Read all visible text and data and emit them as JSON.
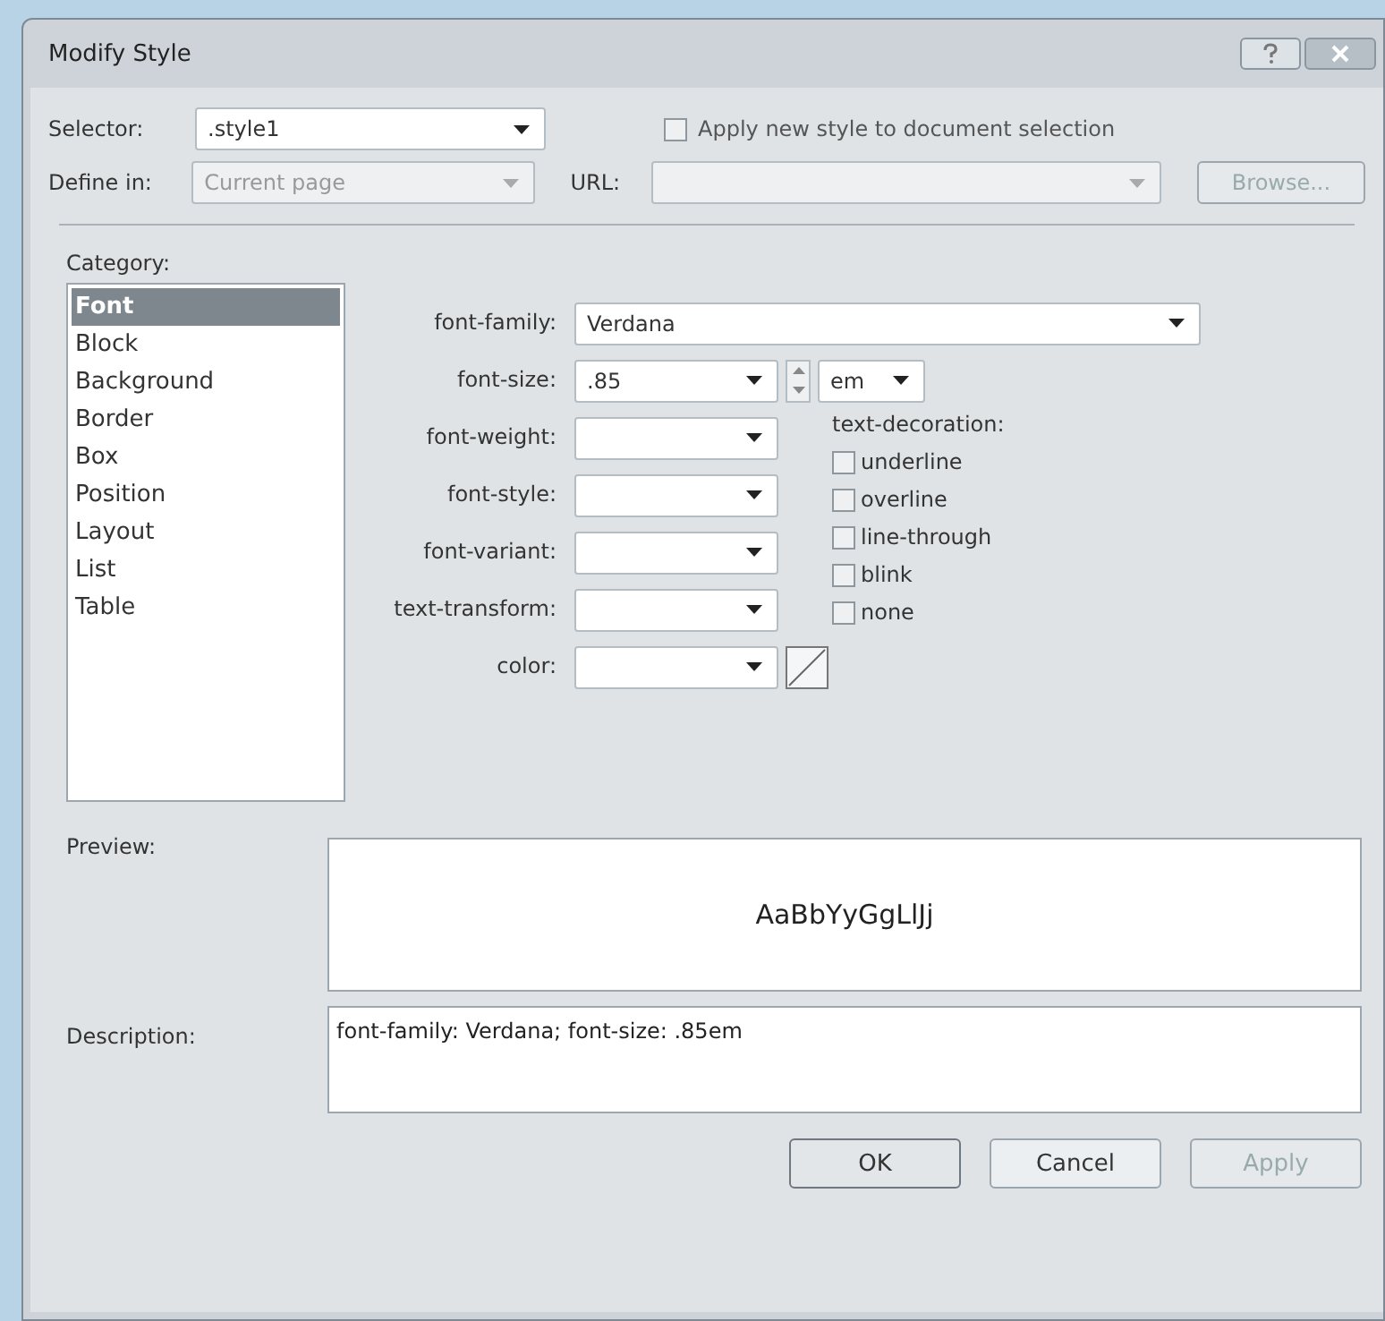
{
  "window": {
    "title": "Modify Style"
  },
  "selector": {
    "label": "Selector:",
    "value": ".style1"
  },
  "apply_to_selection": {
    "label": "Apply new style to document selection",
    "checked": false
  },
  "define_in": {
    "label": "Define in:",
    "value": "Current page",
    "disabled": true
  },
  "url": {
    "label": "URL:",
    "disabled": true
  },
  "browse_button": {
    "label": "Browse...",
    "disabled": true
  },
  "category": {
    "label": "Category:",
    "items": [
      {
        "label": "Font",
        "selected": true
      },
      {
        "label": "Block",
        "selected": false
      },
      {
        "label": "Background",
        "selected": false
      },
      {
        "label": "Border",
        "selected": false
      },
      {
        "label": "Box",
        "selected": false
      },
      {
        "label": "Position",
        "selected": false
      },
      {
        "label": "Layout",
        "selected": false
      },
      {
        "label": "List",
        "selected": false
      },
      {
        "label": "Table",
        "selected": false
      }
    ]
  },
  "properties": [
    {
      "label": "font-family:",
      "value": "Verdana",
      "kind": "wide"
    },
    {
      "label": "font-size:",
      "value": ".85",
      "kind": "size",
      "unit": "em"
    },
    {
      "label": "font-weight:",
      "kind": "dropdown"
    },
    {
      "label": "font-style:",
      "kind": "dropdown"
    },
    {
      "label": "font-variant:",
      "kind": "dropdown"
    },
    {
      "label": "text-transform:",
      "kind": "dropdown"
    },
    {
      "label": "color:",
      "kind": "color"
    }
  ],
  "text_decoration": {
    "label": "text-decoration:",
    "options": [
      {
        "label": "underline",
        "checked": false
      },
      {
        "label": "overline",
        "checked": false
      },
      {
        "label": "line-through",
        "checked": false
      },
      {
        "label": "blink",
        "checked": false
      },
      {
        "label": "none",
        "checked": false
      }
    ]
  },
  "preview": {
    "label": "Preview:",
    "sample": "AaBbYyGgLlJj"
  },
  "description": {
    "label": "Description:",
    "text": "font-family: Verdana; font-size: .85em"
  },
  "buttons": [
    {
      "label": "OK",
      "default": true,
      "disabled": false
    },
    {
      "label": "Cancel",
      "default": false,
      "disabled": false
    },
    {
      "label": "Apply",
      "default": false,
      "disabled": true
    }
  ]
}
